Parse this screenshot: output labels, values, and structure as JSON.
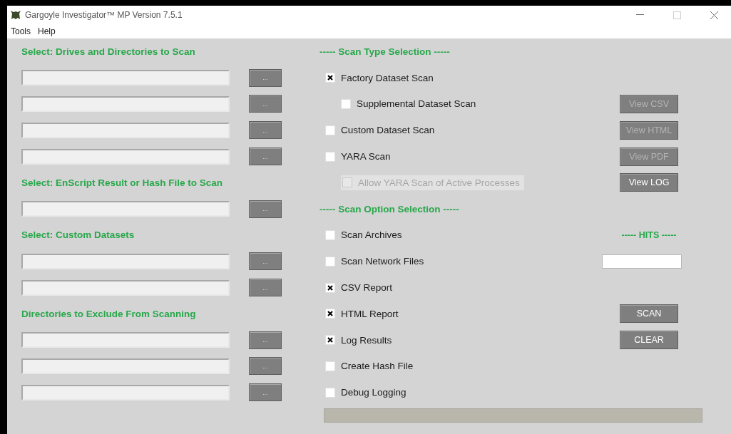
{
  "window": {
    "title": "Gargoyle Investigator™ MP Version 7.5.1"
  },
  "menu": [
    "Tools",
    "Help"
  ],
  "left_sections": [
    {
      "title": "Select: Drives and Directories to Scan",
      "fields": [
        {
          "browse": "..."
        },
        {
          "browse": "..."
        },
        {
          "browse": "..."
        },
        {
          "browse": "..."
        }
      ]
    },
    {
      "title": "Select: EnScript Result or Hash File to Scan",
      "fields": [
        {
          "browse": "..."
        }
      ]
    },
    {
      "title": "Select: Custom Datasets",
      "fields": [
        {
          "browse": "..."
        },
        {
          "browse": "..."
        }
      ]
    },
    {
      "title": "Directories to Exclude From Scanning",
      "fields": [
        {
          "browse": "..."
        },
        {
          "browse": "..."
        },
        {
          "browse": "..."
        }
      ]
    }
  ],
  "scan_type": {
    "title": "----- Scan Type Selection -----",
    "options": [
      {
        "label": "Factory Dataset Scan",
        "checked": true,
        "disabled": false,
        "children": [
          {
            "label": "Supplemental Dataset Scan",
            "checked": false,
            "disabled": false
          }
        ]
      },
      {
        "label": "Custom Dataset Scan",
        "checked": false,
        "disabled": false
      },
      {
        "label": "YARA Scan",
        "checked": false,
        "disabled": false,
        "children": [
          {
            "label": "Allow YARA Scan of Active Processes",
            "checked": false,
            "disabled": true
          }
        ]
      }
    ]
  },
  "view_buttons": [
    {
      "label": "View CSV",
      "disabled": true
    },
    {
      "label": "View HTML",
      "disabled": true
    },
    {
      "label": "View PDF",
      "disabled": true
    },
    {
      "label": "View LOG",
      "disabled": false
    }
  ],
  "scan_options": {
    "title": "----- Scan Option Selection -----",
    "options": [
      {
        "label": "Scan Archives",
        "checked": false
      },
      {
        "label": "Scan Network Files",
        "checked": false
      },
      {
        "label": "CSV Report",
        "checked": true
      },
      {
        "label": "HTML Report",
        "checked": true
      },
      {
        "label": "Log Results",
        "checked": true
      },
      {
        "label": "Create Hash File",
        "checked": false
      },
      {
        "label": "Debug Logging",
        "checked": false
      }
    ]
  },
  "hits": {
    "title": "----- HITS -----"
  },
  "actions": [
    {
      "label": "SCAN"
    },
    {
      "label": "CLEAR"
    }
  ],
  "progress": {
    "level": 0
  }
}
